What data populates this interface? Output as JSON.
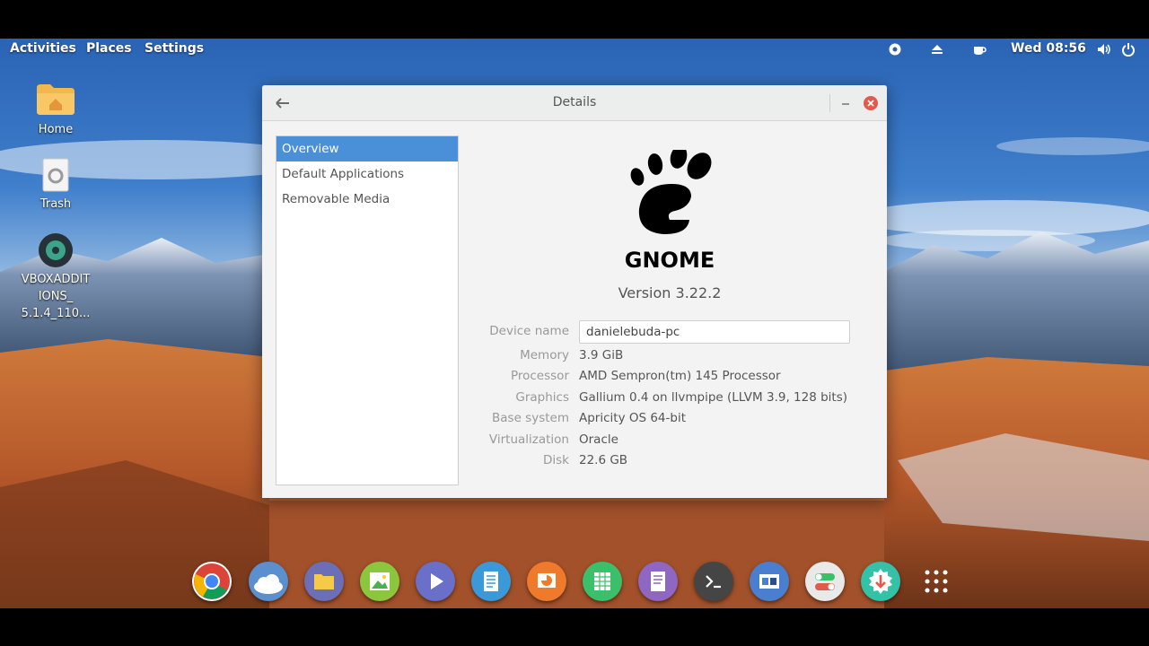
{
  "topbar": {
    "activities": "Activities",
    "places": "Places",
    "settings": "Settings",
    "clock": "Wed 08:56"
  },
  "desktop": {
    "icons": [
      {
        "label": "Home",
        "icon": "folder-home-icon"
      },
      {
        "label": "Trash",
        "icon": "trash-icon"
      },
      {
        "label_lines": [
          "VBOXADDIT",
          "IONS_",
          "5.1.4_110..."
        ],
        "icon": "disc-icon"
      }
    ]
  },
  "window": {
    "title": "Details",
    "sidebar": {
      "items": [
        {
          "label": "Overview",
          "active": true
        },
        {
          "label": "Default Applications",
          "active": false
        },
        {
          "label": "Removable Media",
          "active": false
        }
      ]
    },
    "logo_text": "GNOME",
    "version": "Version 3.22.2",
    "details": {
      "device_name": {
        "label": "Device name",
        "value": "danielebuda-pc"
      },
      "memory": {
        "label": "Memory",
        "value": "3.9 GiB"
      },
      "processor": {
        "label": "Processor",
        "value": "AMD Sempron(tm) 145 Processor"
      },
      "graphics": {
        "label": "Graphics",
        "value": "Gallium 0.4 on llvmpipe (LLVM 3.9, 128 bits)"
      },
      "base_system": {
        "label": "Base system",
        "value": "Apricity OS 64-bit"
      },
      "virtualization": {
        "label": "Virtualization",
        "value": "Oracle"
      },
      "disk": {
        "label": "Disk",
        "value": "22.6 GB"
      }
    }
  },
  "dock": [
    {
      "name": "chrome-icon",
      "color": "#ffffff"
    },
    {
      "name": "cloud-icon",
      "color": "#5a8fd0"
    },
    {
      "name": "files-icon",
      "color": "#6c6fb5"
    },
    {
      "name": "image-viewer-icon",
      "color": "#8cc63f"
    },
    {
      "name": "video-player-icon",
      "color": "#6a6fc9"
    },
    {
      "name": "document-icon",
      "color": "#3a9ad9"
    },
    {
      "name": "presentation-icon",
      "color": "#f07a2b"
    },
    {
      "name": "spreadsheet-icon",
      "color": "#3cbf6a"
    },
    {
      "name": "text-editor-icon",
      "color": "#8f67c2"
    },
    {
      "name": "terminal-icon",
      "color": "#454545"
    },
    {
      "name": "window-switcher-icon",
      "color": "#4a7fd0"
    },
    {
      "name": "settings-toggle-icon",
      "color": "#e9e9e9"
    },
    {
      "name": "software-installer-icon",
      "color": "#33c1a7"
    },
    {
      "name": "app-grid-icon",
      "color": "#ffffff"
    }
  ]
}
